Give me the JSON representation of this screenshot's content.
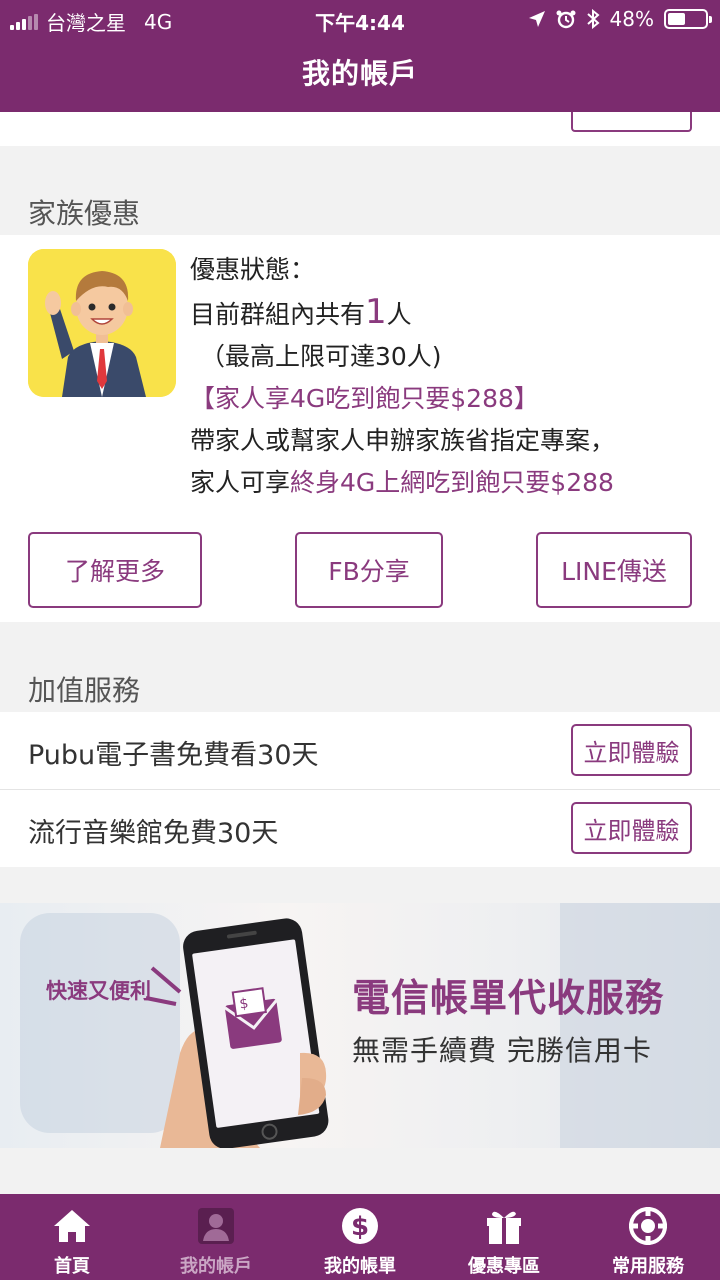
{
  "status_bar": {
    "carrier": "台灣之星",
    "network": "4G",
    "time": "下午4:44",
    "battery_percent": "48%",
    "battery_level": 0.48
  },
  "header": {
    "title": "我的帳戶"
  },
  "family": {
    "section_title": "家族優惠",
    "status_label": "優惠狀態：",
    "group_prefix": "目前群組內共有",
    "group_count": "1",
    "group_suffix": "人",
    "limit": "（最高上限可達30人)",
    "promo_highlight": "【家人享4G吃到飽只要$288】",
    "desc_line1": "帶家人或幫家人申辦家族省指定專案，",
    "desc_line2_prefix": "家人可享",
    "desc_line2_highlight": "終身4G上網吃到飽只要$288",
    "buttons": {
      "learn_more": "了解更多",
      "fb_share": "FB分享",
      "line_send": "LINE傳送"
    }
  },
  "value_added": {
    "section_title": "加值服務",
    "items": [
      {
        "label": "Pubu電子書免費看30天",
        "button": "立即體驗"
      },
      {
        "label": "流行音樂館免費30天",
        "button": "立即體驗"
      }
    ]
  },
  "banner": {
    "tag": "快速又便利",
    "title": "電信帳單代收服務",
    "subtitle": "無需手續費 完勝信用卡"
  },
  "tabbar": {
    "items": [
      {
        "label": "首頁",
        "icon": "home-icon"
      },
      {
        "label": "我的帳戶",
        "icon": "account-icon"
      },
      {
        "label": "我的帳單",
        "icon": "bill-icon"
      },
      {
        "label": "優惠專區",
        "icon": "gift-icon"
      },
      {
        "label": "常用服務",
        "icon": "services-icon"
      }
    ],
    "active_index": 1
  },
  "colors": {
    "brand": "#7b2b6e",
    "accent": "#8a3a7e",
    "avatar_bg": "#f9e24a"
  }
}
